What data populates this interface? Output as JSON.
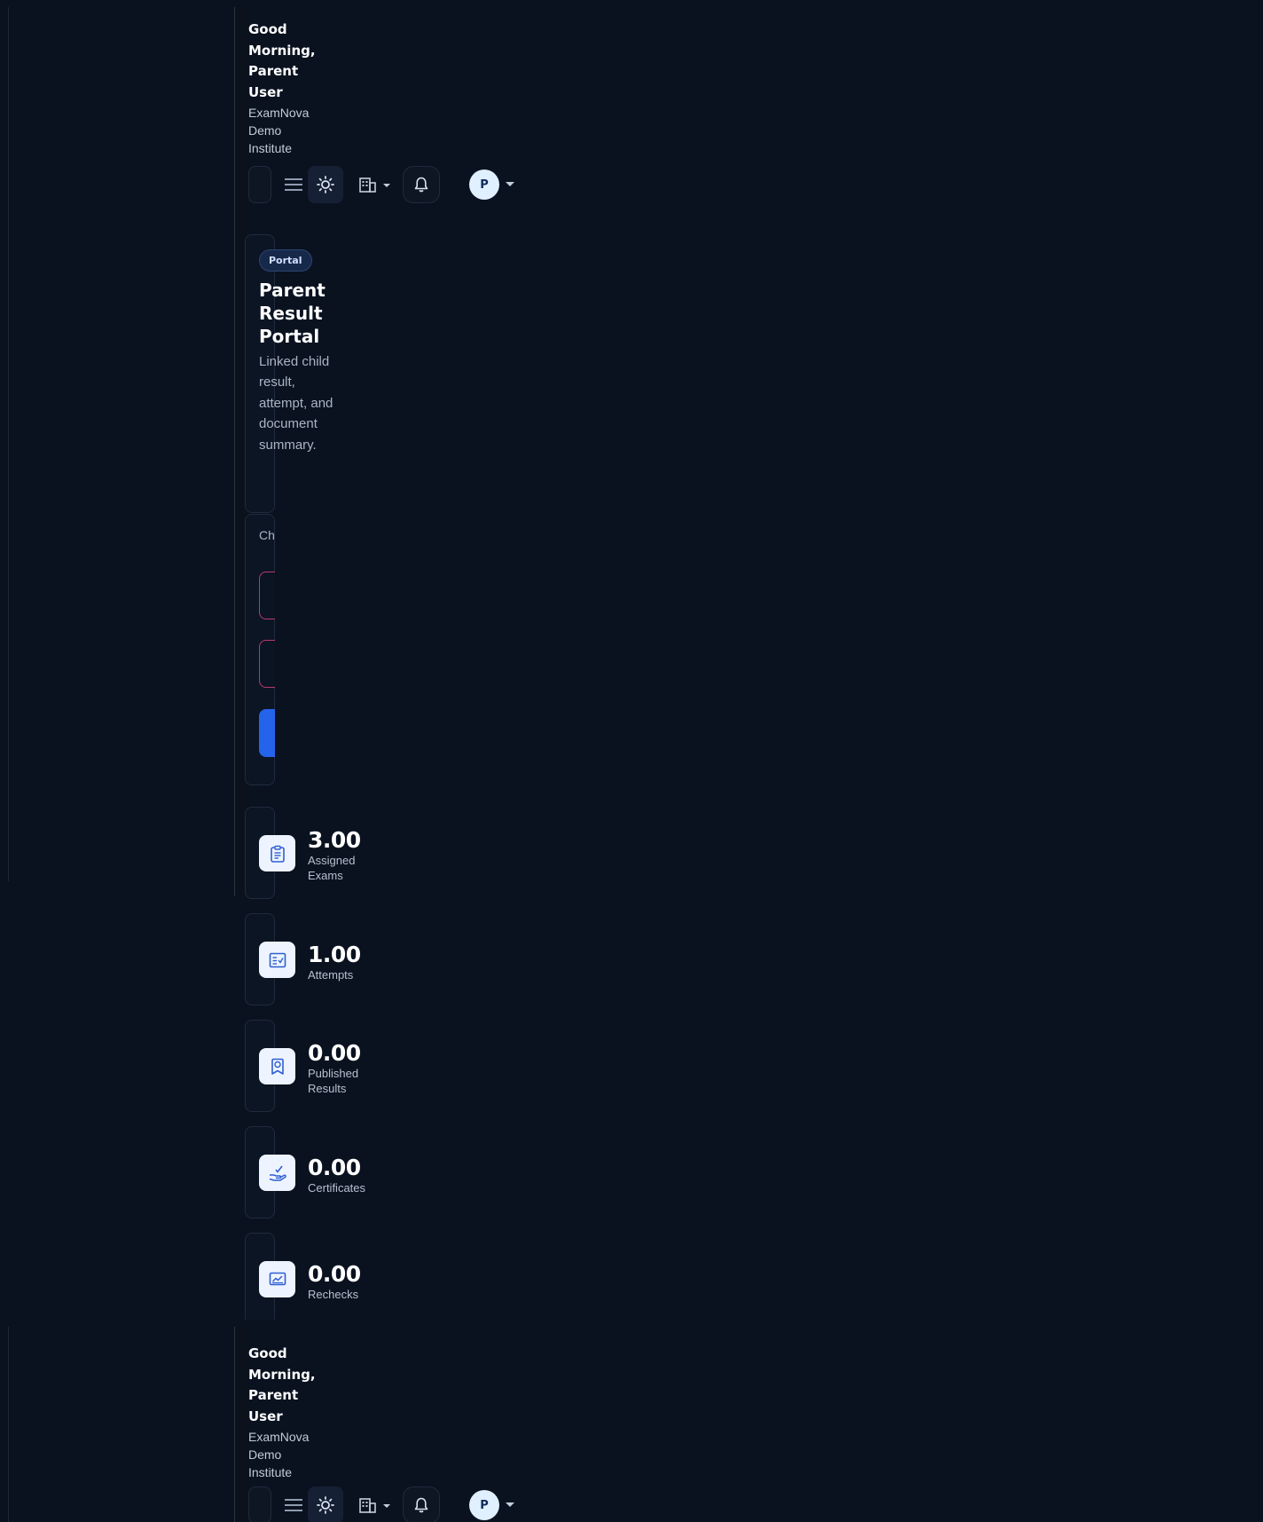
{
  "header": {
    "greeting": "Good Morning, Parent User",
    "institute": "ExamNova Demo Institute",
    "avatar_initial": "P",
    "icons": {
      "menu": "hamburger-menu-icon",
      "theme": "sun-icon",
      "organization": "building-icon",
      "notifications": "bell-icon",
      "caret": "caret-down-icon"
    }
  },
  "portal": {
    "badge": "Portal",
    "title": "Parent Result Portal",
    "description": "Linked child result, attempt, and document summary.",
    "switch_label": "Child switch"
  },
  "stats": [
    {
      "value": "3.00",
      "label": "Assigned Exams",
      "icon": "clipboard-icon"
    },
    {
      "value": "1.00",
      "label": "Attempts",
      "icon": "checklist-icon"
    },
    {
      "value": "0.00",
      "label": "Published Results",
      "icon": "award-icon"
    },
    {
      "value": "0.00",
      "label": "Certificates",
      "icon": "certificate-hand-icon"
    },
    {
      "value": "0.00",
      "label": "Rechecks",
      "icon": "recheck-chart-icon"
    }
  ],
  "colors": {
    "background": "#0a1220",
    "card_border": "#1f2a3c",
    "accent": "#2563eb",
    "field_border": "#b83a6c",
    "avatar_bg": "#e0f0ff"
  }
}
